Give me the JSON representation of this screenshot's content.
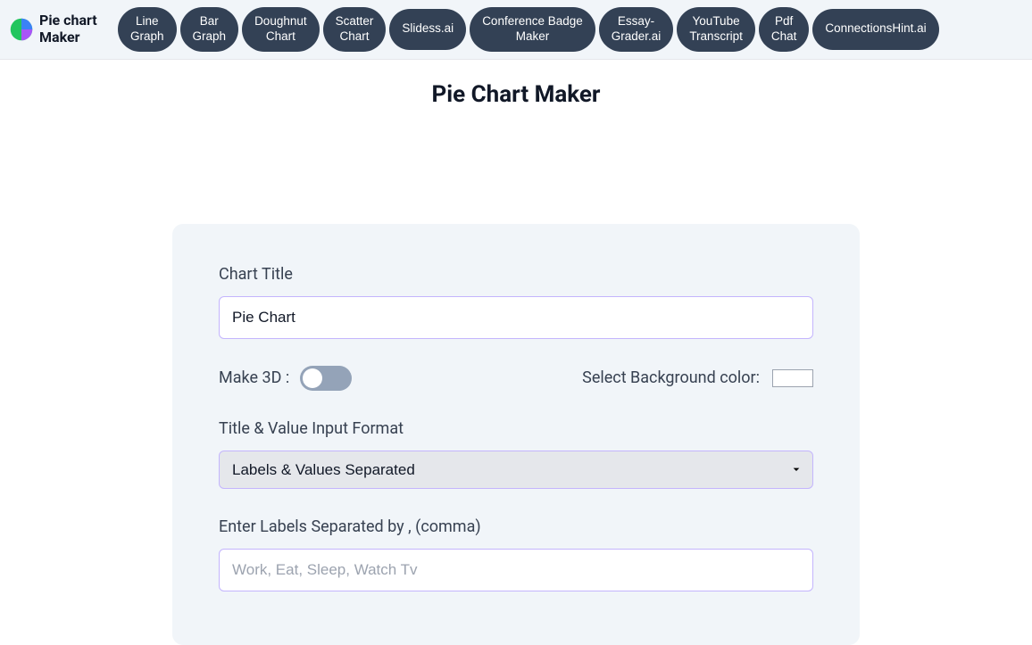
{
  "brand": {
    "name": "Pie chart Maker"
  },
  "nav": {
    "items": [
      "Line\nGraph",
      "Bar\nGraph",
      "Doughnut\nChart",
      "Scatter\nChart",
      "Slidess.ai",
      "Conference Badge\nMaker",
      "Essay-\nGrader.ai",
      "YouTube\nTranscript",
      "Pdf\nChat",
      "ConnectionsHint.ai"
    ]
  },
  "page": {
    "title": "Pie Chart Maker"
  },
  "form": {
    "chartTitle": {
      "label": "Chart Title",
      "value": "Pie Chart"
    },
    "make3d": {
      "label": "Make 3D :"
    },
    "bgColor": {
      "label": "Select Background color:",
      "value": "#ffffff"
    },
    "inputFormat": {
      "label": "Title & Value Input Format",
      "selected": "Labels & Values Separated"
    },
    "labels": {
      "label": "Enter Labels Separated by , (comma)",
      "placeholder": "Work, Eat, Sleep, Watch Tv",
      "value": ""
    }
  }
}
